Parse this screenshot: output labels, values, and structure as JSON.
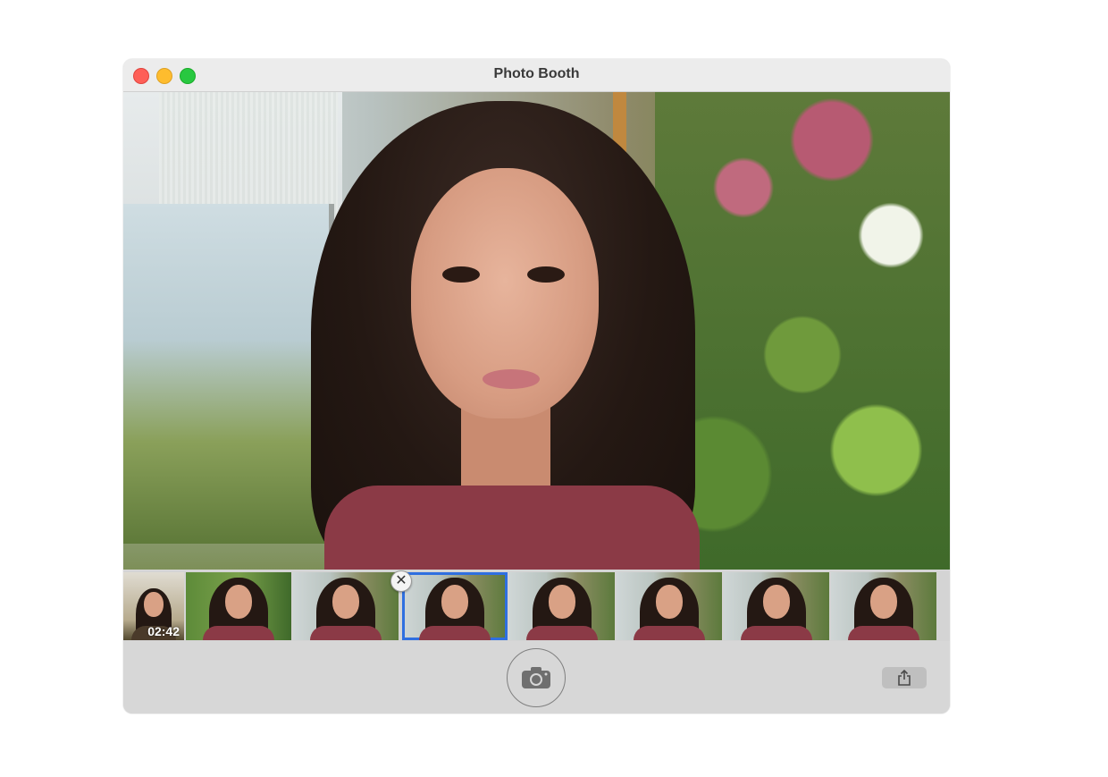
{
  "window": {
    "title": "Photo Booth"
  },
  "preview": {
    "description_icon": "camera-live-preview"
  },
  "strip": {
    "items": [
      {
        "kind": "video",
        "duration": "02:42"
      },
      {
        "kind": "photo"
      },
      {
        "kind": "photo"
      },
      {
        "kind": "photo",
        "selected": true
      },
      {
        "kind": "photo"
      },
      {
        "kind": "photo"
      },
      {
        "kind": "photo"
      },
      {
        "kind": "photo"
      }
    ],
    "delete_badge_glyph": "✕"
  },
  "toolbar": {
    "shutter_icon": "camera-icon",
    "share_icon": "share-icon"
  },
  "colors": {
    "selection_outline": "#2f6fe0",
    "close": "#fe5f57",
    "minimize": "#febc2e",
    "zoom": "#28c840"
  }
}
